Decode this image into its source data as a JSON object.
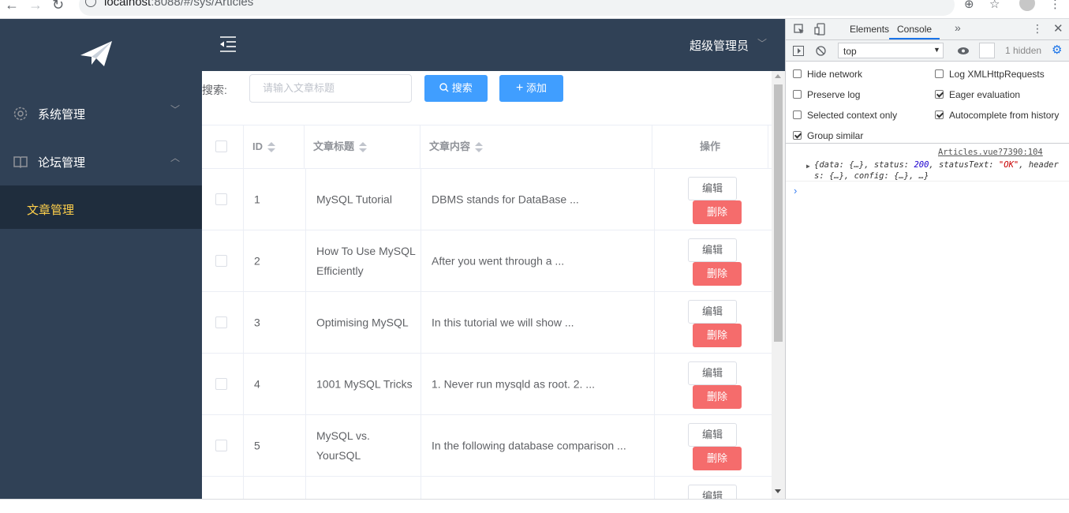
{
  "browser": {
    "url_host": "localhost",
    "url_rest": ":8088/#/sys/Articles"
  },
  "sidebar": {
    "items": [
      {
        "label": "系统管理",
        "icon": "gear-icon",
        "arrow": "﹀"
      },
      {
        "label": "论坛管理",
        "icon": "book-icon",
        "arrow": "︿"
      }
    ],
    "sub_items": [
      {
        "label": "文章管理",
        "active": true
      }
    ]
  },
  "header": {
    "user_name": "超级管理员",
    "caret": "﹀"
  },
  "toolbar": {
    "search_label": "搜索:",
    "search_placeholder": "请输入文章标题",
    "search_button": "搜索",
    "add_button": "添加"
  },
  "table": {
    "columns": [
      "ID",
      "文章标题",
      "文章内容",
      "操作"
    ],
    "edit_label": "编辑",
    "delete_label": "删除",
    "rows": [
      {
        "id": "1",
        "title": "MySQL Tutorial",
        "content": "DBMS stands for DataBase ..."
      },
      {
        "id": "2",
        "title": "How To Use MySQL Efficiently",
        "content": "After you went through a ..."
      },
      {
        "id": "3",
        "title": "Optimising MySQL",
        "content": "In this tutorial we will show ..."
      },
      {
        "id": "4",
        "title": "1001 MySQL Tricks",
        "content": "1. Never run mysqld as root. 2. ..."
      },
      {
        "id": "5",
        "title": "MySQL vs. YourSQL",
        "content": "In the following database comparison ..."
      }
    ]
  },
  "devtools": {
    "tabs": [
      "Elements",
      "Console"
    ],
    "active_tab": "Console",
    "context": "top",
    "hidden_count": "1 hidden",
    "options_left": [
      {
        "label": "Hide network",
        "checked": false
      },
      {
        "label": "Preserve log",
        "checked": false
      },
      {
        "label": "Selected context only",
        "checked": false
      },
      {
        "label": "Group similar",
        "checked": true
      }
    ],
    "options_right": [
      {
        "label": "Log XMLHttpRequests",
        "checked": false
      },
      {
        "label": "Eager evaluation",
        "checked": true
      },
      {
        "label": "Autocomplete from history",
        "checked": true
      }
    ],
    "message_source": "Articles.vue?7390:104",
    "message_parts": {
      "p1": "{data: {…}, status: ",
      "status": "200",
      "p2": ", statusText: ",
      "status_text": "\"OK\"",
      "p3": ", headers: {…}, config: {…}, …}"
    },
    "prompt": "›"
  },
  "colors": {
    "sidebar_bg": "#304156",
    "active_menu": "#ffd04b",
    "primary": "#409eff",
    "danger": "#f56c6c"
  }
}
